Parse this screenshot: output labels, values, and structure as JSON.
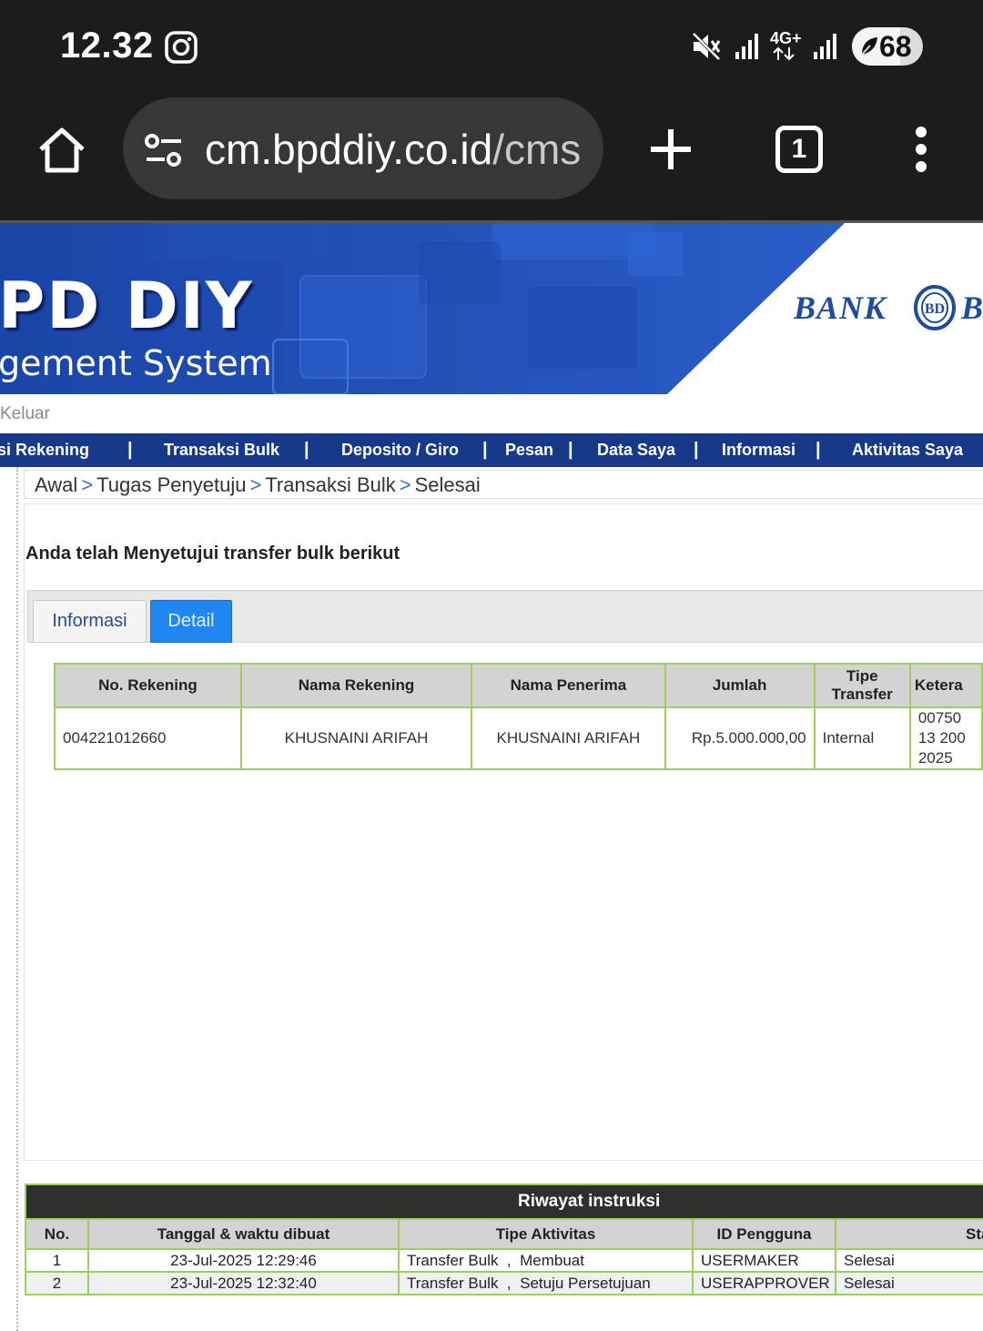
{
  "status_bar": {
    "time": "12.32",
    "network": "4G+",
    "battery": "68",
    "battery_level_percent": 68
  },
  "browser": {
    "url_domain": "cm.bpddiy.co.id",
    "url_path": "/cms",
    "tab_count": "1"
  },
  "banner": {
    "title": "PD DIY",
    "subtitle": "gement System",
    "logo_text": "BANK",
    "logo_text_cut": "B"
  },
  "header": {
    "logout_label": "Keluar"
  },
  "nav": {
    "items": [
      {
        "label": "si Rekening"
      },
      {
        "label": "Transaksi Bulk"
      },
      {
        "label": "Deposito / Giro"
      },
      {
        "label": "Pesan"
      },
      {
        "label": "Data Saya"
      },
      {
        "label": "Informasi"
      },
      {
        "label": "Aktivitas Saya"
      }
    ],
    "separator": "|"
  },
  "breadcrumb": {
    "items": [
      "Awal",
      "Tugas Penyetuju",
      "Transaksi Bulk",
      "Selesai"
    ],
    "separator": ">"
  },
  "main": {
    "message": "Anda telah Menyetujui transfer bulk berikut",
    "tabs": [
      {
        "label": "Informasi",
        "active": false
      },
      {
        "label": "Detail",
        "active": true
      }
    ]
  },
  "detail_table": {
    "headers": [
      "No. Rekening",
      "Nama Rekening",
      "Nama Penerima",
      "Jumlah",
      "Tipe Transfer",
      "Ketera"
    ],
    "rows": [
      {
        "no_rekening": "004221012660",
        "nama_rekening": "KHUSNAINI ARIFAH",
        "nama_penerima": "KHUSNAINI ARIFAH",
        "jumlah": "Rp.5.000.000,00",
        "tipe_transfer": "Internal",
        "keterangan_lines": [
          "00750",
          "13 200",
          "2025"
        ]
      }
    ]
  },
  "history": {
    "title": "Riwayat instruksi",
    "headers": [
      "No.",
      "Tanggal & waktu dibuat",
      "Tipe Aktivitas",
      "ID Pengguna",
      "Sta"
    ],
    "rows": [
      {
        "no": "1",
        "tanggal": "23-Jul-2025 12:29:46",
        "tipe": "Transfer Bulk",
        "aksi": "Membuat",
        "id_pengguna": "USERMAKER",
        "status": "Selesai"
      },
      {
        "no": "2",
        "tanggal": "23-Jul-2025 12:32:40",
        "tipe": "Transfer Bulk",
        "aksi": "Setuju Persetujuan",
        "id_pengguna": "USERAPPROVER",
        "status": "Selesai"
      }
    ],
    "comma": ","
  },
  "colors": {
    "nav_background": "#16398a",
    "banner_blue": "#2352b8",
    "table_border": "#9ccf5b",
    "active_tab": "#1e88f0",
    "history_header": "#2f2f2f"
  }
}
